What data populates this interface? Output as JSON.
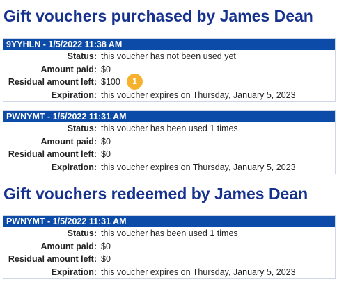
{
  "purchased_title": "Gift vouchers purchased by James Dean",
  "redeemed_title": "Gift vouchers redeemed by James Dean",
  "labels": {
    "status": "Status:",
    "amount_paid": "Amount paid:",
    "residual": "Residual amount left:",
    "expiration": "Expiration:"
  },
  "purchased": [
    {
      "header": "9YYHLN - 1/5/2022 11:38 AM",
      "status": "this voucher has not been used yet",
      "amount_paid": "$0",
      "residual": "$100",
      "expiration": "this voucher expires on Thursday, January 5, 2023"
    },
    {
      "header": "PWNYMT - 1/5/2022 11:31 AM",
      "status": "this voucher has been used 1 times",
      "amount_paid": "$0",
      "residual": "$0",
      "expiration": "this voucher expires on Thursday, January 5, 2023"
    }
  ],
  "redeemed": [
    {
      "header": "PWNYMT - 1/5/2022 11:31 AM",
      "status": "this voucher has been used 1 times",
      "amount_paid": "$0",
      "residual": "$0",
      "expiration": "this voucher expires on Thursday, January 5, 2023"
    }
  ],
  "annotation_badge": "1",
  "colors": {
    "title": "#16328e",
    "header_bg": "#0c4ba8",
    "badge": "#f6b22e"
  }
}
